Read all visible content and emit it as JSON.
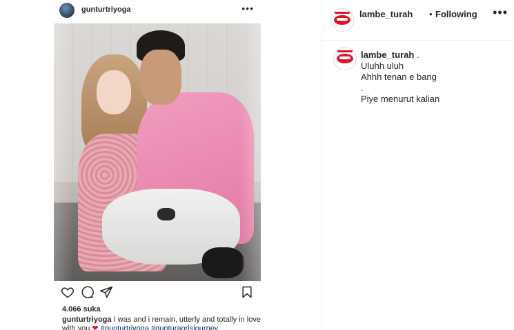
{
  "embedded_post": {
    "username": "gunturtriyoga",
    "more_icon": "ellipsis-icon",
    "likes": "4.066 suka",
    "caption_user": "gunturtriyoga",
    "caption_text": "I was and i remain, utterly and totally in love with you",
    "caption_heart": "❤",
    "caption_tags": "#gunturtriyoga #gunturaprisjourney",
    "icons": [
      "heart-icon",
      "comment-icon",
      "share-icon",
      "bookmark-icon"
    ]
  },
  "header": {
    "username": "lambe_turah",
    "separator": "•",
    "follow_state": "Following",
    "more_icon": "ellipsis-icon"
  },
  "comment": {
    "username": "lambe_turah",
    "lines": [
      ".",
      "Uluhh uluh",
      "Ahhh tenan e bang",
      ".",
      "Piye menurut kalian"
    ]
  },
  "colors": {
    "accent": "#e0152b",
    "text": "#262626",
    "hashtag": "#003569"
  }
}
